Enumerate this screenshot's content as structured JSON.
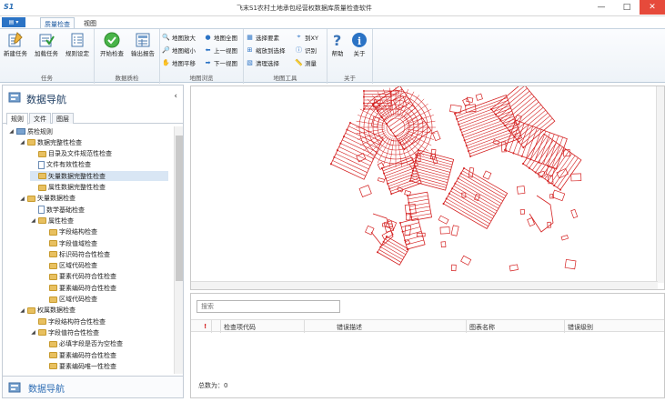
{
  "app": {
    "logo": "S1",
    "title": "飞末S1农村土地承包经营权数据库质量检查软件"
  },
  "window_controls": {
    "minimize": "—",
    "maximize": "□",
    "close": "✕"
  },
  "ribbon_tabs": [
    {
      "label": "质量检查",
      "active": true
    },
    {
      "label": "视图",
      "active": false
    }
  ],
  "ribbon": {
    "groups": [
      {
        "label": "任务",
        "buttons": [
          "新建任务",
          "加载任务",
          "规则设定"
        ]
      },
      {
        "label": "数据质检",
        "buttons": [
          "开始检查",
          "输出报告"
        ]
      },
      {
        "label": "地图浏览",
        "buttons": [
          "地图放大",
          "地图全图",
          "地图缩小",
          "上一视图",
          "地图平移",
          "下一视图"
        ]
      },
      {
        "label": "地图工具",
        "buttons": [
          "选择要素",
          "缩放到选择",
          "清理选择",
          "到XY",
          "识别",
          "测量"
        ]
      },
      {
        "label": "关于",
        "buttons": [
          "帮助",
          "关于"
        ]
      }
    ]
  },
  "left_panel": {
    "title": "数据导航",
    "collapse": "‹",
    "tabs": [
      {
        "label": "规则",
        "active": true
      },
      {
        "label": "文件",
        "active": false
      },
      {
        "label": "图层",
        "active": false
      }
    ],
    "tree": [
      {
        "label": "质检规则",
        "level": 0,
        "type": "root",
        "expanded": true
      },
      {
        "label": "数据完整性检查",
        "level": 1,
        "type": "folder",
        "expanded": true
      },
      {
        "label": "目录及文件规范性检查",
        "level": 2,
        "type": "folder"
      },
      {
        "label": "文件有效性检查",
        "level": 2,
        "type": "doc"
      },
      {
        "label": "矢量数据完整性检查",
        "level": 2,
        "type": "folder",
        "selected": true
      },
      {
        "label": "属性数据完整性检查",
        "level": 2,
        "type": "folder"
      },
      {
        "label": "矢量数据检查",
        "level": 1,
        "type": "folder",
        "expanded": true
      },
      {
        "label": "数学基础检查",
        "level": 2,
        "type": "doc"
      },
      {
        "label": "属性检查",
        "level": 2,
        "type": "folder",
        "expanded": true
      },
      {
        "label": "字段结构检查",
        "level": 3,
        "type": "folder"
      },
      {
        "label": "字段值域检查",
        "level": 3,
        "type": "folder"
      },
      {
        "label": "标识码符合性检查",
        "level": 3,
        "type": "folder"
      },
      {
        "label": "区域代码检查",
        "level": 3,
        "type": "folder"
      },
      {
        "label": "要素代码符合性检查",
        "level": 3,
        "type": "folder"
      },
      {
        "label": "要素编码符合性检查",
        "level": 3,
        "type": "folder"
      },
      {
        "label": "区域代码检查",
        "level": 3,
        "type": "folder"
      },
      {
        "label": "权属数据检查",
        "level": 1,
        "type": "folder",
        "expanded": true
      },
      {
        "label": "字段结构符合性检查",
        "level": 2,
        "type": "folder"
      },
      {
        "label": "字段值符合性检查",
        "level": 2,
        "type": "folder",
        "expanded": true
      },
      {
        "label": "必填字段是否为空检查",
        "level": 3,
        "type": "folder"
      },
      {
        "label": "要素编码符合性检查",
        "level": 3,
        "type": "folder"
      },
      {
        "label": "要素编码唯一性检查",
        "level": 3,
        "type": "folder"
      }
    ],
    "footer_title": "数据导航"
  },
  "results": {
    "search_placeholder": "搜索",
    "columns": [
      "!",
      "",
      "检查项代码",
      "错误描述",
      "图表名称",
      "错误级别"
    ],
    "status": "总数为：0"
  },
  "colors": {
    "accent": "#2b73c5",
    "map_lines": "#d42020"
  }
}
